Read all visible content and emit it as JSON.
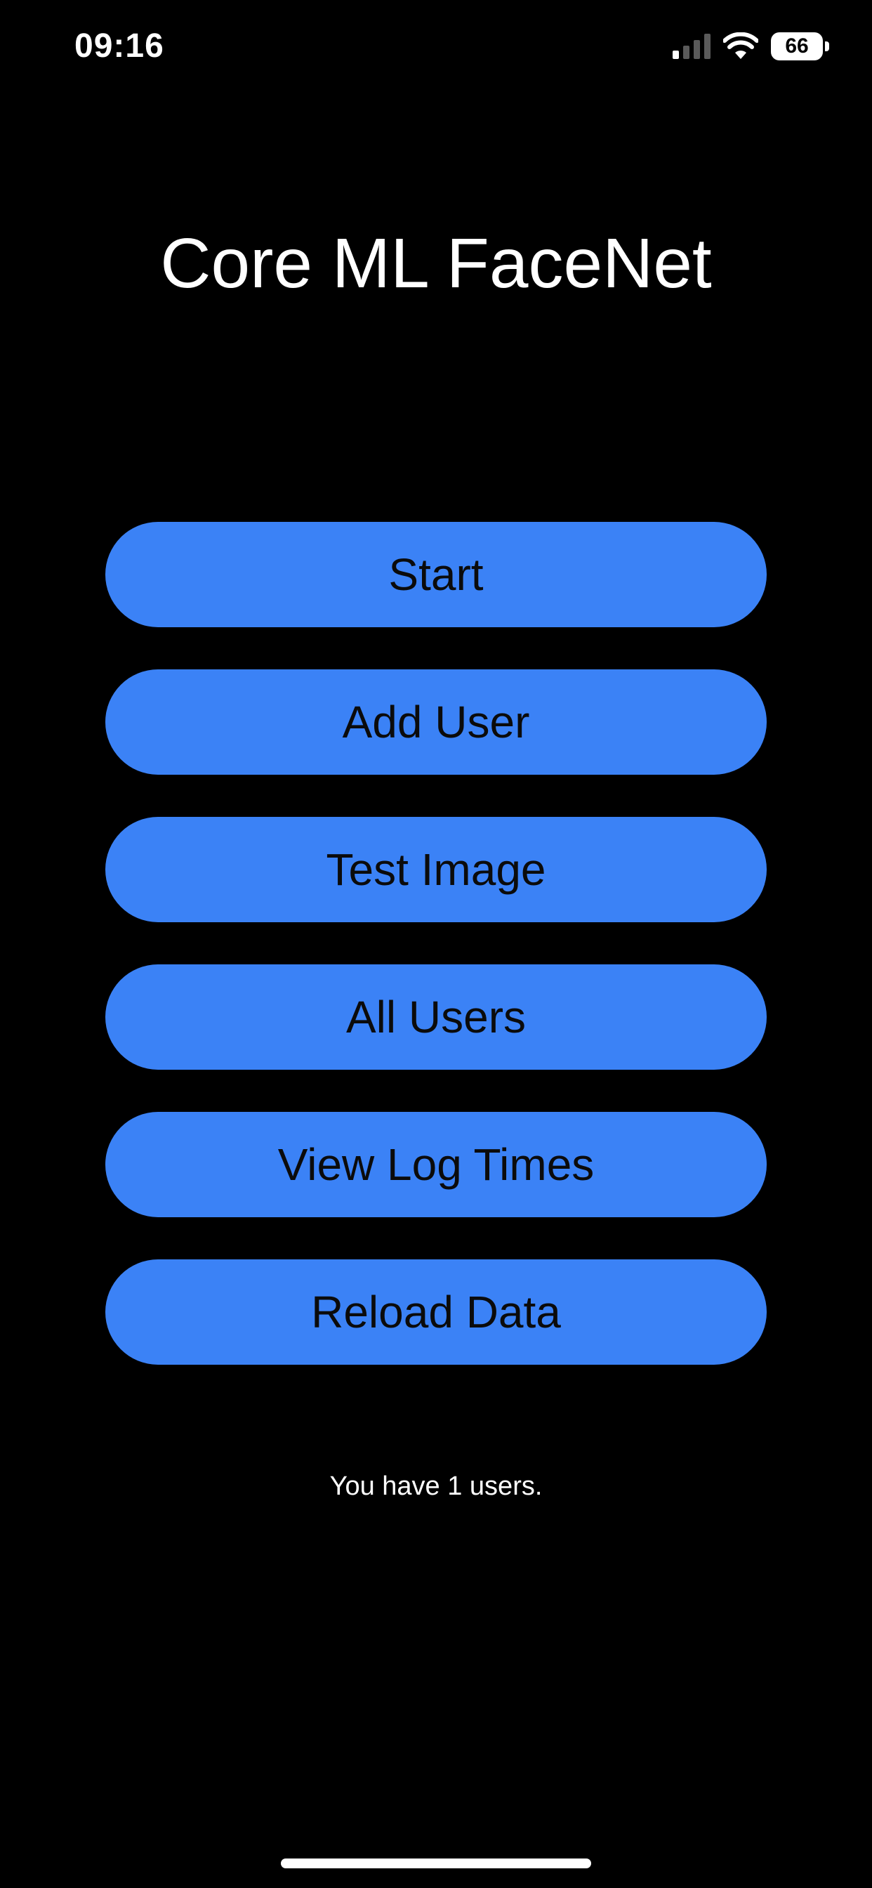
{
  "status_bar": {
    "time": "09:16",
    "battery_level": "66",
    "icons": [
      "signal-icon",
      "wifi-icon",
      "battery-icon"
    ]
  },
  "title": "Core ML FaceNet",
  "buttons": [
    {
      "label": "Start"
    },
    {
      "label": "Add User"
    },
    {
      "label": "Test Image"
    },
    {
      "label": "All Users"
    },
    {
      "label": "View Log Times"
    },
    {
      "label": "Reload Data"
    }
  ],
  "footer": {
    "user_count_text": "You have 1 users."
  },
  "colors": {
    "background": "#000000",
    "button": "#3b82f6",
    "button_text": "#0b0b0b",
    "text": "#ffffff"
  }
}
